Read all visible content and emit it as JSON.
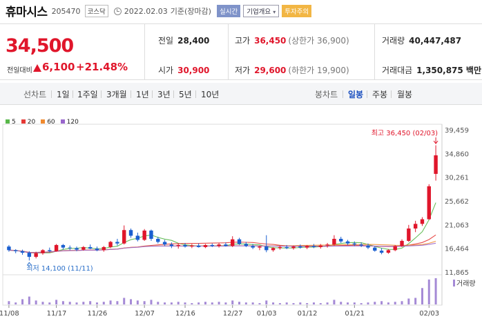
{
  "header": {
    "name": "휴마시스",
    "code": "205470",
    "market": "코스닥",
    "date": "2022.02.03",
    "basis": "기준(장마감)",
    "realtime": "실시간",
    "company": "기업개요",
    "warning": "투자주의"
  },
  "quote": {
    "price": "34,500",
    "change_label": "전일대비",
    "change": "6,100",
    "change_pct": "+21.48%",
    "prev_label": "전일",
    "prev": "28,400",
    "high_label": "고가",
    "high": "36,450",
    "high_limit": "(상한가 36,900)",
    "volume_label": "거래량",
    "volume": "40,447,487",
    "open_label": "시가",
    "open": "30,900",
    "low_label": "저가",
    "low": "29,600",
    "low_limit": "(하한가 19,900)",
    "value_label": "거래대금",
    "value": "1,350,875 백만"
  },
  "tabs": {
    "line": "선차트",
    "d1": "1일",
    "w1": "1주일",
    "m3": "3개월",
    "y1": "1년",
    "y3": "3년",
    "y5": "5년",
    "y10": "10년",
    "candle": "봉차트",
    "daily": "일봉",
    "weekly": "주봉",
    "monthly": "월봉"
  },
  "colors": {
    "up": "#e0162b",
    "down": "#1a5fd0",
    "ma5": "#59b84a",
    "ma20": "#e53935",
    "ma60": "#f08a2e",
    "ma120": "#9966cc",
    "volume": "#a58ad6"
  },
  "chart_data": {
    "type": "candlestick",
    "legend": [
      "5",
      "20",
      "60",
      "120"
    ],
    "y_ticks": [
      "39,459",
      "34,860",
      "30,261",
      "25,662",
      "21,063",
      "16,464",
      "11,865"
    ],
    "ylim": [
      11865,
      39459
    ],
    "x_ticks": [
      "11/08",
      "11/17",
      "11/26",
      "12/07",
      "12/16",
      "12/27",
      "01/03",
      "01/12",
      "01/21",
      "02/03"
    ],
    "max_label": "최고 36,450 (02/03)",
    "min_label": "최저 14,100 (11/11)",
    "volume_label": "거래량",
    "candles": [
      [
        16800,
        17100,
        15800,
        16100
      ],
      [
        16100,
        16300,
        15500,
        15900
      ],
      [
        15900,
        16200,
        15200,
        15600
      ],
      [
        15600,
        15900,
        14100,
        14800
      ],
      [
        14800,
        15800,
        14500,
        15500
      ],
      [
        15500,
        16300,
        15200,
        16100
      ],
      [
        16100,
        16600,
        15700,
        15900
      ],
      [
        15900,
        17300,
        15800,
        17100
      ],
      [
        17100,
        17300,
        16200,
        16600
      ],
      [
        16600,
        17000,
        16100,
        16500
      ],
      [
        16500,
        16800,
        15900,
        16200
      ],
      [
        16200,
        16900,
        16000,
        16700
      ],
      [
        16700,
        17200,
        16300,
        16400
      ],
      [
        16400,
        16800,
        15900,
        16100
      ],
      [
        16100,
        16900,
        15800,
        16700
      ],
      [
        16700,
        17900,
        16500,
        17700
      ],
      [
        17700,
        18300,
        17000,
        17400
      ],
      [
        17400,
        20900,
        17200,
        20000
      ],
      [
        20000,
        20300,
        18500,
        18900
      ],
      [
        18900,
        19500,
        17800,
        18100
      ],
      [
        18100,
        20200,
        17900,
        19900
      ],
      [
        19900,
        20100,
        17900,
        18300
      ],
      [
        18300,
        18700,
        17400,
        17700
      ],
      [
        17700,
        18100,
        16900,
        17200
      ],
      [
        17200,
        17600,
        16500,
        16900
      ],
      [
        16900,
        17400,
        16400,
        17100
      ],
      [
        17100,
        17500,
        16600,
        16800
      ],
      [
        16800,
        17300,
        16500,
        17000
      ],
      [
        17000,
        17400,
        16600,
        16700
      ],
      [
        16700,
        17300,
        16500,
        17100
      ],
      [
        17100,
        17400,
        16700,
        16900
      ],
      [
        16900,
        17500,
        16600,
        17200
      ],
      [
        17200,
        17600,
        16800,
        16900
      ],
      [
        16900,
        18800,
        16700,
        18200
      ],
      [
        18200,
        18500,
        17100,
        17300
      ],
      [
        17300,
        17700,
        16700,
        16900
      ],
      [
        16900,
        17300,
        16300,
        16600
      ],
      [
        16600,
        17000,
        16100,
        16800
      ],
      [
        16800,
        19000,
        15700,
        16100
      ],
      [
        16100,
        16700,
        15800,
        16500
      ],
      [
        16500,
        17000,
        16200,
        16700
      ],
      [
        16700,
        17100,
        16300,
        16500
      ],
      [
        16500,
        17000,
        16200,
        16800
      ],
      [
        16800,
        17200,
        16400,
        16600
      ],
      [
        16600,
        17100,
        16300,
        16900
      ],
      [
        16900,
        17300,
        16500,
        16700
      ],
      [
        16700,
        17300,
        16400,
        17000
      ],
      [
        17000,
        17500,
        16600,
        17200
      ],
      [
        17200,
        19000,
        17000,
        18300
      ],
      [
        18300,
        18700,
        17500,
        17800
      ],
      [
        17800,
        18100,
        17100,
        17400
      ],
      [
        17400,
        17800,
        16900,
        17200
      ],
      [
        17200,
        17600,
        16700,
        17000
      ],
      [
        17000,
        17400,
        16300,
        16600
      ],
      [
        16600,
        16900,
        15800,
        16000
      ],
      [
        16000,
        16500,
        15300,
        15600
      ],
      [
        15600,
        16300,
        15400,
        16100
      ],
      [
        16100,
        17100,
        15900,
        16900
      ],
      [
        16900,
        18200,
        16700,
        17900
      ],
      [
        17900,
        21000,
        17700,
        20300
      ],
      [
        20300,
        21800,
        19600,
        21200
      ],
      [
        21200,
        22500,
        20800,
        22100
      ],
      [
        22100,
        28900,
        22000,
        28500
      ],
      [
        30900,
        36450,
        29600,
        34500
      ]
    ],
    "volumes": [
      5,
      3,
      8,
      12,
      6,
      4,
      3,
      7,
      5,
      4,
      3,
      4,
      5,
      3,
      4,
      6,
      5,
      10,
      8,
      6,
      5,
      7,
      4,
      3,
      3,
      4,
      3,
      2,
      3,
      4,
      3,
      4,
      3,
      6,
      4,
      3,
      3,
      2,
      6,
      3,
      2,
      3,
      2,
      3,
      2,
      3,
      2,
      3,
      7,
      4,
      3,
      3,
      2,
      3,
      4,
      5,
      3,
      4,
      5,
      9,
      10,
      25,
      38,
      40
    ]
  }
}
